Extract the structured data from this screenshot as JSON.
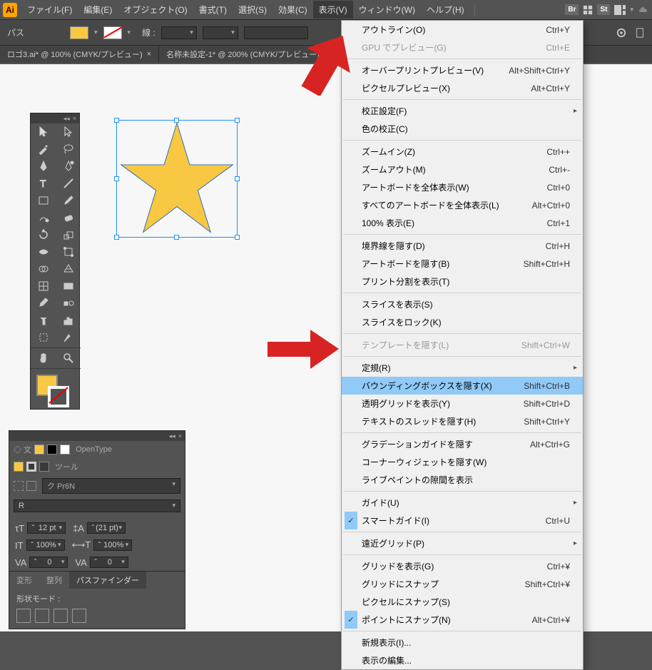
{
  "app": {
    "iconText": "Ai"
  },
  "menubar": {
    "file": "ファイル(F)",
    "edit": "編集(E)",
    "object": "オブジェクト(O)",
    "type": "書式(T)",
    "select": "選択(S)",
    "effect": "効果(C)",
    "view": "表示(V)",
    "window": "ウィンドウ(W)",
    "help": "ヘルプ(H)",
    "br": "Br",
    "st": "St"
  },
  "controlbar": {
    "selection": "パス",
    "strokeLabel": "線 :"
  },
  "tabs": {
    "0": "ロゴ3.ai* @ 100% (CMYK/プレビュー)",
    "1": "名称未設定-1* @ 200% (CMYK/プレビュー)"
  },
  "dropdown": {
    "outline": {
      "label": "アウトライン(O)",
      "key": "Ctrl+Y"
    },
    "gpu": {
      "label": "GPU でプレビュー(G)",
      "key": "Ctrl+E"
    },
    "overprint": {
      "label": "オーバープリントプレビュー(V)",
      "key": "Alt+Shift+Ctrl+Y"
    },
    "pixel": {
      "label": "ピクセルプレビュー(X)",
      "key": "Alt+Ctrl+Y"
    },
    "proofsetup": {
      "label": "校正設定(F)"
    },
    "proofcolors": {
      "label": "色の校正(C)"
    },
    "zoomin": {
      "label": "ズームイン(Z)",
      "key": "Ctrl++"
    },
    "zoomout": {
      "label": "ズームアウト(M)",
      "key": "Ctrl+-"
    },
    "fitart": {
      "label": "アートボードを全体表示(W)",
      "key": "Ctrl+0"
    },
    "fitall": {
      "label": "すべてのアートボードを全体表示(L)",
      "key": "Alt+Ctrl+0"
    },
    "actual": {
      "label": "100% 表示(E)",
      "key": "Ctrl+1"
    },
    "hideedge": {
      "label": "境界線を隠す(D)",
      "key": "Ctrl+H"
    },
    "hideart": {
      "label": "アートボードを隠す(B)",
      "key": "Shift+Ctrl+H"
    },
    "showprint": {
      "label": "プリント分割を表示(T)"
    },
    "showslice": {
      "label": "スライスを表示(S)"
    },
    "lockslice": {
      "label": "スライスをロック(K)"
    },
    "hidetpl": {
      "label": "テンプレートを隠す(L)",
      "key": "Shift+Ctrl+W"
    },
    "rulers": {
      "label": "定規(R)"
    },
    "hidebbox": {
      "label": "バウンディングボックスを隠す(X)",
      "key": "Shift+Ctrl+B"
    },
    "showtgrid": {
      "label": "透明グリッドを表示(Y)",
      "key": "Shift+Ctrl+D"
    },
    "hidethread": {
      "label": "テキストのスレッドを隠す(H)",
      "key": "Shift+Ctrl+Y"
    },
    "gradient": {
      "label": "グラデーションガイドを隠す",
      "key": "Alt+Ctrl+G"
    },
    "corner": {
      "label": "コーナーウィジェットを隠す(W)"
    },
    "livepaint": {
      "label": "ライブペイントの隙間を表示"
    },
    "guides": {
      "label": "ガイド(U)"
    },
    "smart": {
      "label": "スマートガイド(I)",
      "key": "Ctrl+U"
    },
    "pgrid": {
      "label": "遠近グリッド(P)"
    },
    "showgrid": {
      "label": "グリッドを表示(G)",
      "key": "Ctrl+¥"
    },
    "snapgrid": {
      "label": "グリッドにスナップ",
      "key": "Shift+Ctrl+¥"
    },
    "snappix": {
      "label": "ピクセルにスナップ(S)"
    },
    "snappt": {
      "label": "ポイントにスナップ(N)",
      "key": "Alt+Ctrl+¥"
    },
    "newview": {
      "label": "新規表示(I)..."
    },
    "editview": {
      "label": "表示の編集..."
    }
  },
  "props": {
    "opentype": "OpenType",
    "tool": "ツール",
    "font": "ク Pr6N",
    "weight": "R",
    "size": {
      "label": "12 pt"
    },
    "leading": {
      "label": "(21 pt)"
    },
    "hscale": {
      "label": "100%"
    },
    "vscale": {
      "label": "100%"
    },
    "tracking": {
      "label": "0"
    },
    "kerning": {
      "label": "0"
    },
    "transform": "変形",
    "align": "整列",
    "pathfinder": "パスファインダー",
    "shapemode": "形状モード :"
  }
}
